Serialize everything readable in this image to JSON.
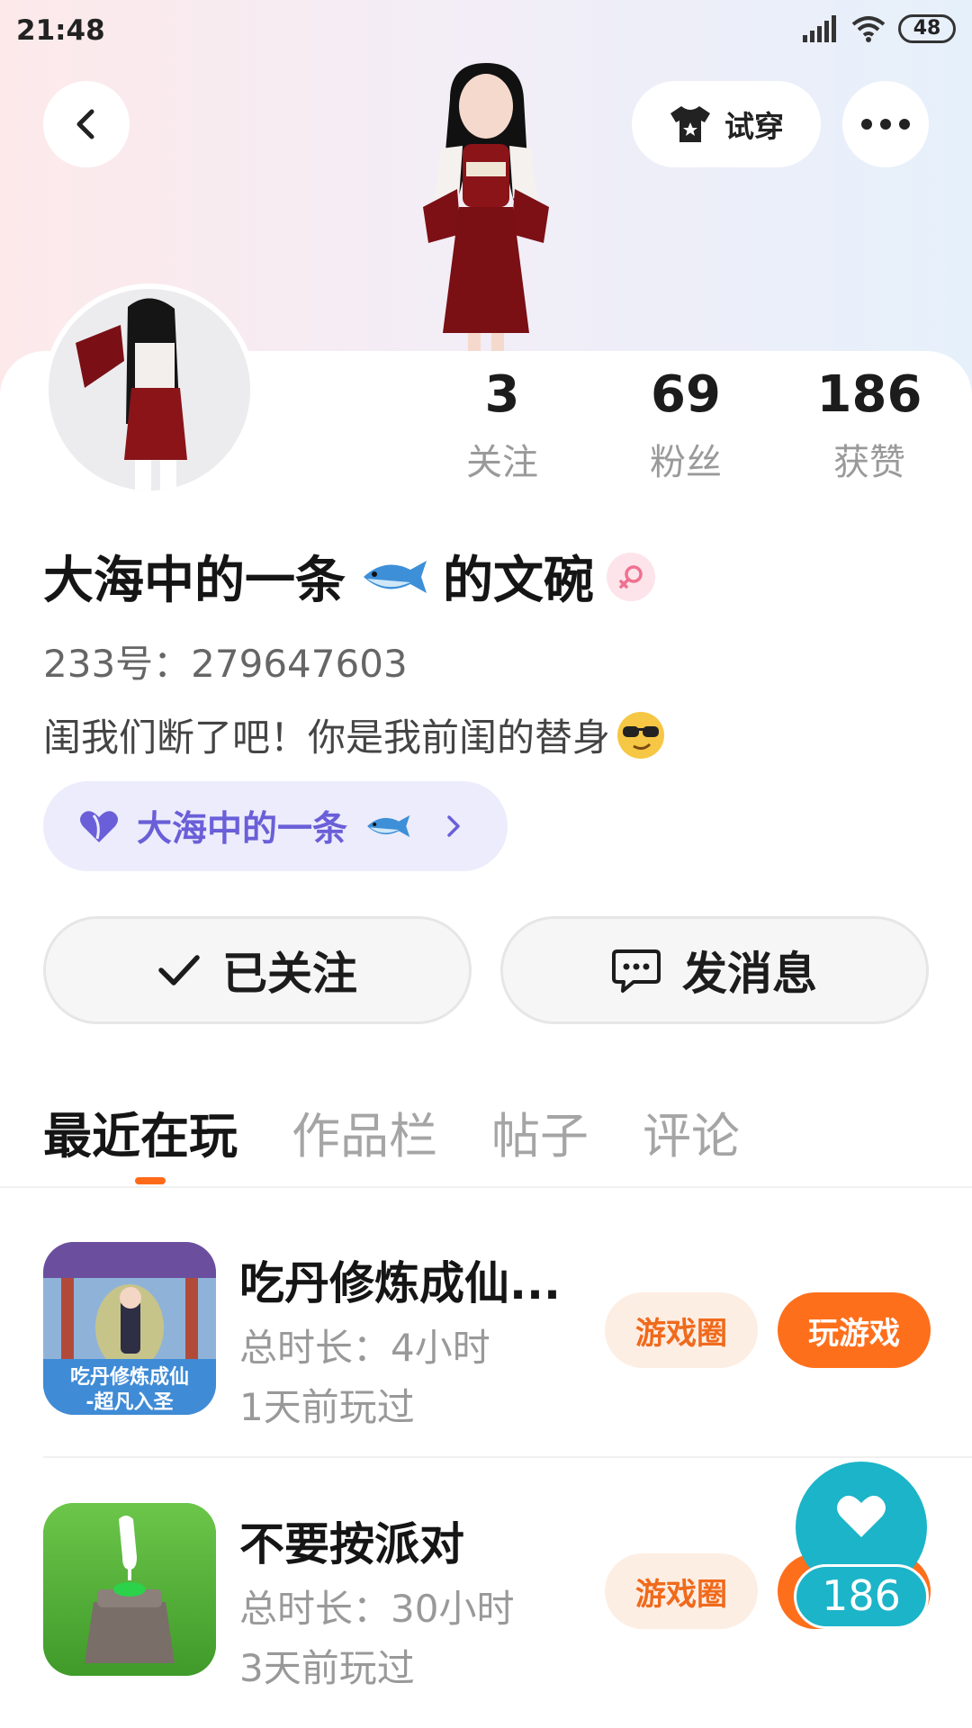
{
  "status_bar": {
    "time": "21:48",
    "battery": "48"
  },
  "header": {
    "tryon_label": "试穿"
  },
  "stats": [
    {
      "value": "3",
      "label": "关注"
    },
    {
      "value": "69",
      "label": "粉丝"
    },
    {
      "value": "186",
      "label": "获赞"
    }
  ],
  "profile": {
    "name_part1": "大海中的一条",
    "name_part2": "的文碗",
    "uid": "233号：279647603",
    "bio": "闺我们断了吧！你是我前闺的替身",
    "group_label": "大海中的一条"
  },
  "actions": {
    "follow_label": "已关注",
    "message_label": "发消息"
  },
  "tabs": [
    "最近在玩",
    "作品栏",
    "帖子",
    "评论"
  ],
  "games": [
    {
      "title": "吃丹修炼成仙...",
      "duration": "总时长：4小时",
      "last_played": "1天前玩过",
      "thumb_caption_1": "吃丹修炼成仙",
      "thumb_caption_2": "-超凡入圣",
      "circle_label": "游戏圈",
      "play_label": "玩游戏"
    },
    {
      "title": "不要按派对",
      "duration": "总时长：30小时",
      "last_played": "3天前玩过",
      "circle_label": "游戏圈"
    }
  ],
  "like_fab": {
    "count": "186"
  },
  "colors": {
    "accent": "#fe6f1c",
    "group_chip": "#6a5fd8",
    "like": "#1cb4c8"
  }
}
